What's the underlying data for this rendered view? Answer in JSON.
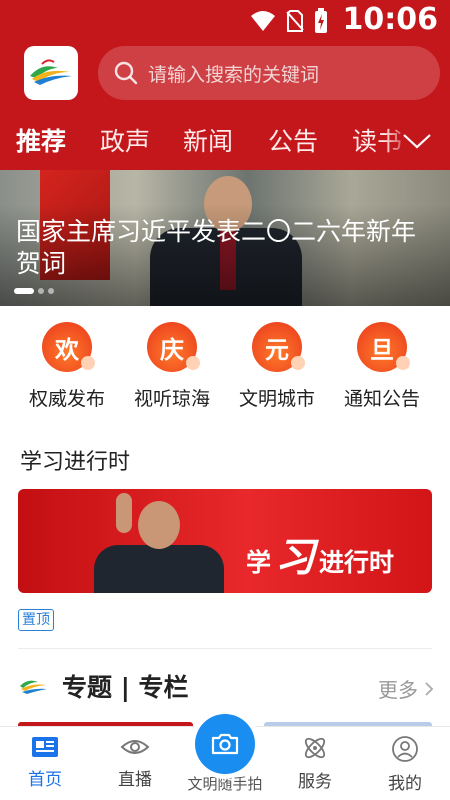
{
  "status_bar": {
    "time": "10:06"
  },
  "search": {
    "placeholder": "请输入搜索的关键词"
  },
  "tabs": [
    {
      "label": "推荐",
      "active": true
    },
    {
      "label": "政声",
      "active": false
    },
    {
      "label": "新闻",
      "active": false
    },
    {
      "label": "公告",
      "active": false
    },
    {
      "label": "读书",
      "active": false
    }
  ],
  "banner": {
    "title": "国家主席习近平发表二〇二六年新年贺词",
    "page_count": 3,
    "active_page": 1
  },
  "quick_nav": [
    {
      "glyph": "欢",
      "label": "权威发布"
    },
    {
      "glyph": "庆",
      "label": "视听琼海"
    },
    {
      "glyph": "元",
      "label": "文明城市"
    },
    {
      "glyph": "旦",
      "label": "通知公告"
    }
  ],
  "study_section": {
    "title": "学习进行时",
    "card_text_left": "学",
    "card_text_big": "习",
    "card_text_right": "进行时",
    "pin_label": "置顶"
  },
  "topic_section": {
    "title": "专题 | 专栏",
    "more_label": "更多"
  },
  "tabbar": {
    "items": [
      {
        "label": "首页",
        "icon": "news-icon",
        "active": true
      },
      {
        "label": "直播",
        "icon": "eye-icon",
        "active": false
      },
      {
        "label": "文明随手拍",
        "icon": "camera-icon",
        "active": false
      },
      {
        "label": "服务",
        "icon": "atom-icon",
        "active": false
      },
      {
        "label": "我的",
        "icon": "user-icon",
        "active": false
      }
    ]
  },
  "colors": {
    "brand_red": "#c4171c",
    "accent_blue": "#1a73e8",
    "badge_orange": "#e8361c"
  }
}
